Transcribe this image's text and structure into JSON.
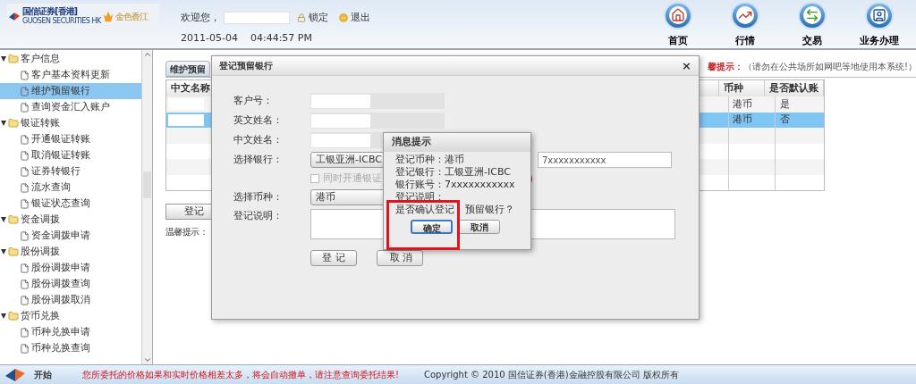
{
  "header": {
    "logo": {
      "name": "国信证券[香港]",
      "subtitle": "GUOSEN SECURITIES HK",
      "brand": "金色香江"
    },
    "welcome": "欢迎您，",
    "lock": "锁定",
    "logout": "退出",
    "date": "2011-05-04",
    "time": "04:44:57 PM",
    "nav": [
      {
        "label": "首页",
        "kind": "home"
      },
      {
        "label": "行情",
        "kind": "chart"
      },
      {
        "label": "交易",
        "kind": "trade"
      },
      {
        "label": "业务办理",
        "kind": "service"
      }
    ]
  },
  "sidebar": {
    "items": [
      {
        "label": "客户信息",
        "expanded": true,
        "children": [
          {
            "label": "客户基本资料更新",
            "selected": false
          },
          {
            "label": "维护预留银行",
            "selected": true
          },
          {
            "label": "查询资金汇入账户",
            "selected": false
          }
        ]
      },
      {
        "label": "银证转账",
        "expanded": true,
        "children": [
          {
            "label": "开通银证转账",
            "selected": false
          },
          {
            "label": "取消银证转账",
            "selected": false
          },
          {
            "label": "证券转银行",
            "selected": false
          },
          {
            "label": "流水查询",
            "selected": false
          },
          {
            "label": "银证状态查询",
            "selected": false
          }
        ]
      },
      {
        "label": "资金调拨",
        "expanded": true,
        "children": [
          {
            "label": "资金调拨申请",
            "selected": false
          }
        ]
      },
      {
        "label": "股份调拨",
        "expanded": true,
        "children": [
          {
            "label": "股份调拨申请",
            "selected": false
          },
          {
            "label": "股份调拨查询",
            "selected": false
          },
          {
            "label": "股份调拨取消",
            "selected": false
          }
        ]
      },
      {
        "label": "货币兑换",
        "expanded": true,
        "children": [
          {
            "label": "币种兑换申请",
            "selected": false
          },
          {
            "label": "币种兑换查询",
            "selected": false
          }
        ]
      }
    ]
  },
  "main": {
    "tab": "维护预留",
    "notice_title": "馨提示：",
    "notice": "（请勿在公共场所如网吧等地使用本系统!）",
    "table": {
      "columns": [
        "中文名称",
        "",
        "币种",
        "是否默认账"
      ],
      "rows": [
        {
          "currency": "港币",
          "default": "是",
          "selected": false
        },
        {
          "currency": "港币",
          "default": "否",
          "selected": true
        }
      ]
    },
    "register_button": "登记",
    "tip_label": "温馨提示："
  },
  "register_dialog": {
    "title": "登记预留银行",
    "close": "×",
    "labels": [
      "客户号：",
      "英文姓名：",
      "中文姓名：",
      "选择银行："
    ],
    "bank": "工银亚洲-ICBC",
    "account": "7xxxxxxxxxxx",
    "open_link": {
      "label": "同时开通银证",
      "checked": false
    },
    "red_note": "）",
    "currency_label": "选择币种：",
    "currency": "港币",
    "remark_label": "登记说明：",
    "buttons": [
      "登 记",
      "取 消"
    ]
  },
  "message_dialog": {
    "title": "消息提示",
    "lines": [
      "登记币种：港币",
      "登记银行：工银亚洲-ICBC",
      "银行账号：7xxxxxxxxxxx",
      "登记说明："
    ],
    "question": {
      "before": "是否确认登记",
      "after": "预留银行？"
    },
    "buttons": [
      {
        "label": "确定",
        "focused": true
      },
      {
        "label": "取消",
        "focused": false
      }
    ]
  },
  "status_bar": {
    "start": "开始",
    "warning": "您所委托的价格如果和实时价格相差太多，将会自动撤单，请注意查询委托结果!",
    "copyright": "Copyright © 2010 国信证券(香港)金融控股有限公司 版权所有"
  }
}
